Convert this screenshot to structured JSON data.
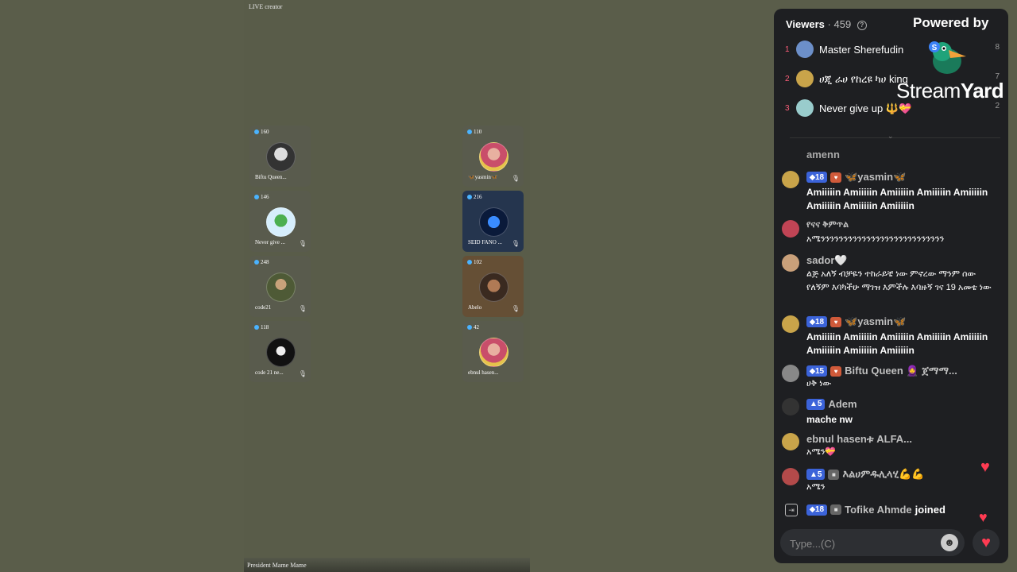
{
  "stage": {
    "live_label": "LIVE creator",
    "host_name": "President Mame Mame",
    "guests": [
      {
        "count": "160",
        "name": "Biftu Queen...",
        "col": 0,
        "row": 0
      },
      {
        "count": "146",
        "name": "Never give ...",
        "col": 0,
        "row": 1
      },
      {
        "count": "248",
        "name": "code21",
        "col": 0,
        "row": 2
      },
      {
        "count": "118",
        "name": "code 21 ne...",
        "col": 0,
        "row": 3
      },
      {
        "count": "110",
        "name": "🦋yasmin🦋",
        "col": 1,
        "row": 0
      },
      {
        "count": "216",
        "name": "SEID FANO ...",
        "col": 1,
        "row": 1
      },
      {
        "count": "102",
        "name": "Abelo",
        "col": 1,
        "row": 2
      },
      {
        "count": "42",
        "name": "ebnul hasen...",
        "col": 1,
        "row": 3
      }
    ]
  },
  "panel": {
    "viewers_label": "Viewers",
    "viewers_count": "· 459",
    "powered_by": "Powered by",
    "brand_a": "Stream",
    "brand_b": "Yard",
    "top_viewers": [
      {
        "rank": "1",
        "name": "Master Sherefudin",
        "num": "8"
      },
      {
        "rank": "2",
        "name": "ሀጂ ራሀ የከረዩ ካሀ king",
        "num": "7"
      },
      {
        "rank": "3",
        "name": "Never give up 🔱💝",
        "num": "2"
      }
    ],
    "messages": [
      {
        "id": "m0",
        "user": "amenn",
        "badge": "",
        "text": ""
      },
      {
        "id": "m1",
        "user": "🦋yasmin🦋",
        "badge": "18",
        "text": "Amiiiiin Amiiiiin Amiiiiin Amiiiiin Amiiiiin Amiiiiin Amiiiiin Amiiiiin"
      },
      {
        "id": "m2",
        "user": "የናና ቅምጥል",
        "badge": "",
        "text": "አሜንንንንንንንንንንንንንንንንንንንንንንንንንንን"
      },
      {
        "id": "m3",
        "user": "sador🤍",
        "badge": "",
        "text": "ልጅ አለኝ ብቻዬን ተከራይቼ ነው ምኖረው ማንም ሰው የለኝም እባካችሁ ማገዝ እምችሉ እባዙኝ ገና 19 አመቴ ነው"
      },
      {
        "id": "m4",
        "user": "🦋yasmin🦋",
        "badge": "18",
        "text": "Amiiiiin Amiiiiin Amiiiiin Amiiiiin Amiiiiin Amiiiiin Amiiiiin Amiiiiin"
      },
      {
        "id": "m5",
        "user": "Biftu Queen 🧕 ጀማማ...",
        "badge": "15",
        "text": "ሀቅ ነው"
      },
      {
        "id": "m6",
        "user": "Adem",
        "badge": "5",
        "text": "mache nw"
      },
      {
        "id": "m7",
        "user": "ebnul hasenቱ ALFA...",
        "badge": "",
        "text": "አሜን💝"
      },
      {
        "id": "m8",
        "user": "እልሀምዱሊላሂ💪💪",
        "badge": "5",
        "text": "አሜን"
      },
      {
        "id": "m9",
        "user": "Tofike Ahmde",
        "badge": "18",
        "text": "joined"
      }
    ],
    "input_placeholder": "Type...(C)",
    "emoji_icon": "☻",
    "heart_icon": "♥"
  }
}
